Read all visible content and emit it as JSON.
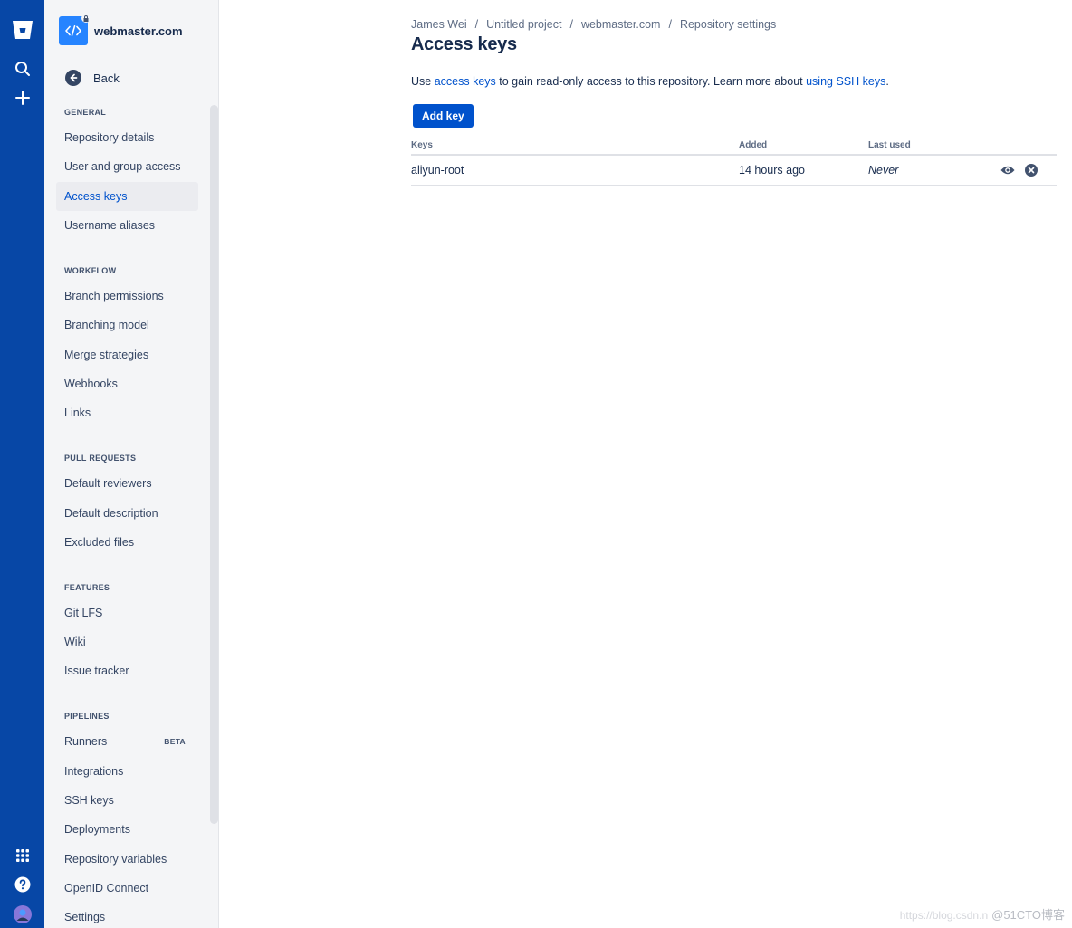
{
  "nav_rail": {
    "logo": "bitbucket-logo",
    "icons_top": [
      "search-icon",
      "plus-icon"
    ],
    "icons_bottom": [
      "apps-grid-icon",
      "help-icon",
      "user-avatar"
    ]
  },
  "repo": {
    "name": "webmaster.com"
  },
  "back_label": "Back",
  "sections": [
    {
      "heading": "GENERAL",
      "items": [
        "Repository details",
        "User and group access",
        "Access keys",
        "Username aliases"
      ]
    },
    {
      "heading": "WORKFLOW",
      "items": [
        "Branch permissions",
        "Branching model",
        "Merge strategies",
        "Webhooks",
        "Links"
      ]
    },
    {
      "heading": "PULL REQUESTS",
      "items": [
        "Default reviewers",
        "Default description",
        "Excluded files"
      ]
    },
    {
      "heading": "FEATURES",
      "items": [
        "Git LFS",
        "Wiki",
        "Issue tracker"
      ]
    },
    {
      "heading": "PIPELINES",
      "items": [
        "Runners",
        "Integrations",
        "SSH keys",
        "Deployments",
        "Repository variables",
        "OpenID Connect",
        "Settings"
      ]
    }
  ],
  "active_item": "Access keys",
  "beta_label": "BETA",
  "breadcrumbs": [
    "James Wei",
    "Untitled project",
    "webmaster.com",
    "Repository settings"
  ],
  "breadcrumb_separator": "/",
  "page_title": "Access keys",
  "description": {
    "t1": "Use ",
    "link1": "access keys",
    "t2": " to gain read-only access to this repository. Learn more about ",
    "link2": "using SSH keys",
    "t3": "."
  },
  "add_key_label": "Add key",
  "table": {
    "headers": [
      "Keys",
      "Added",
      "Last used"
    ],
    "rows": [
      {
        "key": "aliyun-root",
        "added": "14 hours ago",
        "last_used": "Never"
      }
    ]
  },
  "watermark": {
    "faint": "https://blog.csdn.n",
    "text": "@51CTO博客"
  },
  "colors": {
    "rail": "#0747a6",
    "accent": "#0052cc",
    "sidebar_bg": "#f4f5f7"
  }
}
